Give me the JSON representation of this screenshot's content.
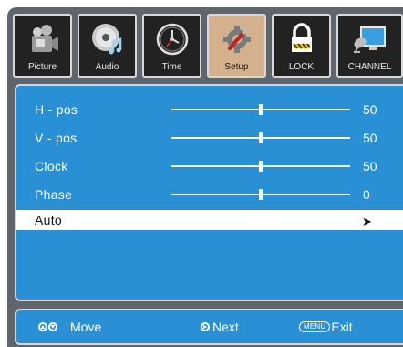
{
  "tabs": [
    {
      "label": "Picture",
      "icon": "camera-icon",
      "active": false
    },
    {
      "label": "Audio",
      "icon": "cd-disc-icon",
      "active": false
    },
    {
      "label": "Time",
      "icon": "clock-icon",
      "active": false
    },
    {
      "label": "Setup",
      "icon": "tools-icon",
      "active": true
    },
    {
      "label": "LOCK",
      "icon": "padlock-icon",
      "active": false
    },
    {
      "label": "CHANNEL",
      "icon": "satellite-dish-icon",
      "active": false
    }
  ],
  "settings": [
    {
      "name": "H - pos",
      "value": "50",
      "level": 0.5
    },
    {
      "name": "V - pos",
      "value": "50",
      "level": 0.5
    },
    {
      "name": "Clock",
      "value": "50",
      "level": 0.5
    },
    {
      "name": "Phase",
      "value": "0",
      "level": 0.5
    }
  ],
  "auto_item": {
    "name": "Auto",
    "arrow": "➤",
    "selected": true
  },
  "footer": {
    "move_label": "Move",
    "next_label": "Next",
    "menu_key": "MENU",
    "exit_label": "Exit"
  },
  "colors": {
    "panel_blue": "#2a90d6",
    "frame_gray": "#5f656c",
    "active_tab": "#d2b18c",
    "tab_bg": "#222222"
  }
}
